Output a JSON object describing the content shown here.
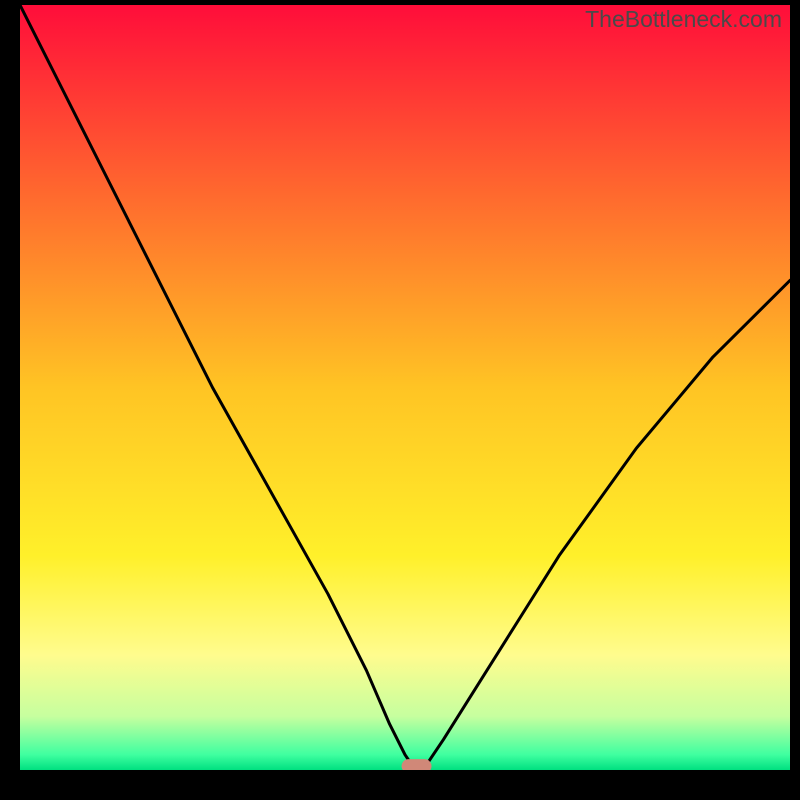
{
  "watermark": "TheBottleneck.com",
  "chart_data": {
    "type": "line",
    "title": "",
    "xlabel": "",
    "ylabel": "",
    "xlim": [
      0,
      100
    ],
    "ylim": [
      0,
      100
    ],
    "x": [
      0,
      5,
      10,
      15,
      20,
      25,
      30,
      35,
      40,
      45,
      48,
      50,
      51,
      52,
      53,
      55,
      60,
      65,
      70,
      75,
      80,
      85,
      90,
      95,
      100
    ],
    "values": [
      100,
      90,
      80,
      70,
      60,
      50,
      41,
      32,
      23,
      13,
      6,
      2,
      0.5,
      0.5,
      1,
      4,
      12,
      20,
      28,
      35,
      42,
      48,
      54,
      59,
      64
    ],
    "background_gradient": {
      "type": "linear-vertical",
      "stops": [
        {
          "offset": 0,
          "color": "#ff0d3a"
        },
        {
          "offset": 0.25,
          "color": "#ff6a2e"
        },
        {
          "offset": 0.5,
          "color": "#ffc424"
        },
        {
          "offset": 0.72,
          "color": "#fff02a"
        },
        {
          "offset": 0.85,
          "color": "#fffc8e"
        },
        {
          "offset": 0.93,
          "color": "#c6ff9f"
        },
        {
          "offset": 0.98,
          "color": "#3fffa0"
        },
        {
          "offset": 1,
          "color": "#00e080"
        }
      ]
    },
    "marker": {
      "x": 51.5,
      "y": 0.5,
      "color": "#d08878",
      "shape": "rounded-rect"
    }
  }
}
